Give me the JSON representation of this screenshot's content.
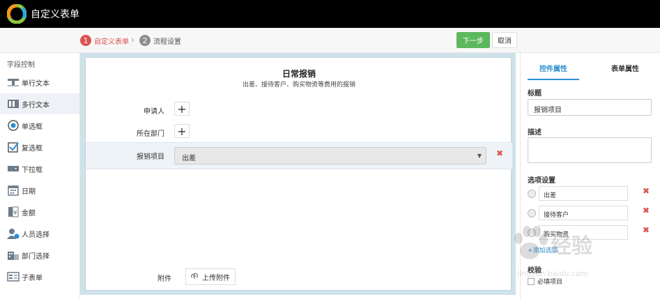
{
  "header": {
    "app_title": "自定义表单"
  },
  "steps": [
    {
      "num": "1",
      "label": "自定义表单"
    },
    {
      "num": "2",
      "label": "流程设置"
    }
  ],
  "toolbar": {
    "next_label": "下一步",
    "cancel_label": "取消"
  },
  "sidebar": {
    "title": "字段控制",
    "items": [
      {
        "label": "单行文本",
        "icon": "single-line-text-icon"
      },
      {
        "label": "多行文本",
        "icon": "multi-line-text-icon"
      },
      {
        "label": "单选框",
        "icon": "radio-icon"
      },
      {
        "label": "复选框",
        "icon": "checkbox-icon"
      },
      {
        "label": "下拉框",
        "icon": "dropdown-icon"
      },
      {
        "label": "日期",
        "icon": "calendar-icon"
      },
      {
        "label": "金额",
        "icon": "currency-icon"
      },
      {
        "label": "人员选择",
        "icon": "person-select-icon"
      },
      {
        "label": "部门选择",
        "icon": "department-icon"
      },
      {
        "label": "子表单",
        "icon": "subform-icon"
      }
    ]
  },
  "form": {
    "title": "日常报销",
    "description": "出差、接待客户、购买物资等费用的报销",
    "fields": {
      "applicant_label": "申请人",
      "department_label": "所在部门",
      "expense_item_label": "报销项目",
      "expense_item_value": "出差",
      "attachment_label": "附件",
      "upload_label": "上传附件"
    }
  },
  "properties": {
    "tabs": [
      "控件属性",
      "表单属性"
    ],
    "title_label": "标题",
    "title_value": "报销项目",
    "desc_label": "描述",
    "options_label": "选项设置",
    "options": [
      "出差",
      "接待客户",
      "购买物资"
    ],
    "add_option": "+添加选项",
    "validation_label": "校验",
    "required_label": "必填项目"
  },
  "watermark": {
    "brand": "经验",
    "url": "jingyan.baidu.com"
  },
  "colors": {
    "accent_red": "#d9534f",
    "accent_green": "#5cb85c",
    "accent_blue": "#2b8fd1"
  }
}
